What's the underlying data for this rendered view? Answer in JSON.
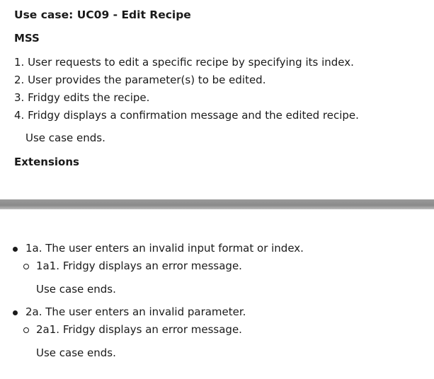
{
  "section_top": {
    "title": "Use case: UC09 - Edit Recipe",
    "mss_heading": "MSS",
    "steps": [
      "1. User requests to edit a specific recipe by specifying its index.",
      "2. User provides the parameter(s) to be edited.",
      "3. Fridgy edits the recipe.",
      "4. Fridgy displays a confirmation message and the edited recipe."
    ],
    "ends": "Use case ends.",
    "extensions_heading": "Extensions"
  },
  "section_bottom": {
    "extensions": [
      {
        "label": "1a. The user enters an invalid input format or index.",
        "sub": "1a1. Fridgy displays an error message.",
        "ends": "Use case ends."
      },
      {
        "label": "2a. The user enters an invalid parameter.",
        "sub": "2a1. Fridgy displays an error message.",
        "ends": "Use case ends."
      }
    ]
  }
}
